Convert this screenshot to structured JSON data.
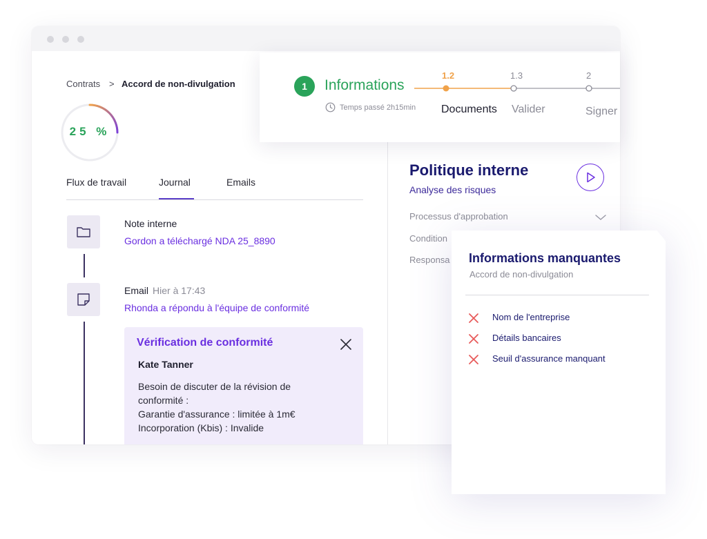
{
  "breadcrumb": {
    "root": "Contrats",
    "separator": ">",
    "current": "Accord de non-divulgation"
  },
  "progress": {
    "value": 0.25,
    "label": "25 %"
  },
  "tabs": [
    {
      "label": "Flux de travail",
      "active": false
    },
    {
      "label": "Journal",
      "active": true
    },
    {
      "label": "Emails",
      "active": false
    }
  ],
  "timeline": [
    {
      "icon": "folder-icon",
      "title": "Note interne",
      "time": "",
      "link": "Gordon a téléchargé NDA 25_8890"
    },
    {
      "icon": "note-icon",
      "title": "Email",
      "time": "Hier à 17:43",
      "link": "Rhonda a répondu à l'équipe de conformité"
    }
  ],
  "compliance_card": {
    "title": "Vérification de conformité",
    "author": "Kate Tanner",
    "lines": [
      "Besoin de discuter de la révision de",
      "conformité :",
      "Garantie d'assurance : limitée à 1m€",
      "Incorporation (Kbis) : Invalide"
    ]
  },
  "stepper": {
    "current_step_number": "1",
    "current_step_label": "Informations",
    "time_spent": "Temps passé 2h15min",
    "steps": [
      {
        "number": "1.2",
        "label": "Documents",
        "state": "active"
      },
      {
        "number": "1.3",
        "label": "Valider",
        "state": "upcoming"
      },
      {
        "number": "2",
        "label": "Signer",
        "state": "upcoming"
      }
    ]
  },
  "policy_panel": {
    "title": "Politique interne",
    "subtitle": "Analyse des risques",
    "rows": [
      "Processus d'approbation",
      "Condition",
      "Responsa"
    ]
  },
  "missing_info": {
    "title": "Informations manquantes",
    "subtitle": "Accord de non-divulgation",
    "items": [
      "Nom de l'entreprise",
      "Détails bancaires",
      "Seuil d'assurance manquant"
    ]
  },
  "colors": {
    "accent_purple": "#6a2fe0",
    "navy": "#1a1a6e",
    "success_green": "#2aa35a",
    "active_orange": "#f0a24a",
    "error_red": "#e85a5a"
  }
}
